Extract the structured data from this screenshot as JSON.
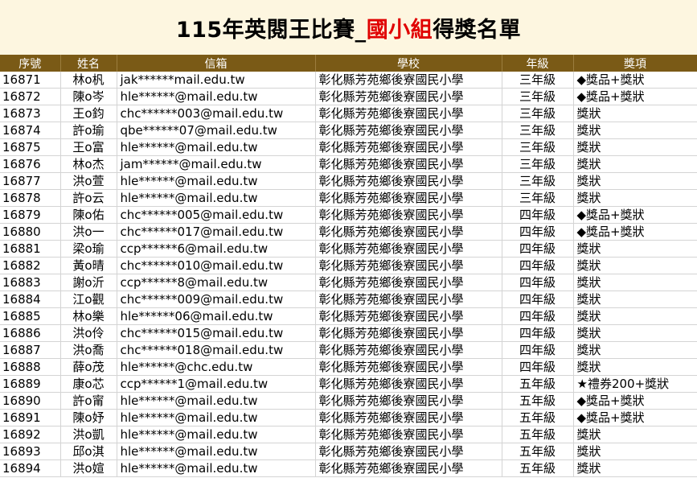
{
  "title": {
    "part1": "115年英閱王比賽_",
    "part2": "國小組",
    "part3": "得獎名單"
  },
  "headers": [
    "序號",
    "姓名",
    "信箱",
    "學校",
    "年級",
    "獎項"
  ],
  "rows": [
    [
      "16871",
      "林o杋",
      "jak******mail.edu.tw",
      "彰化縣芳苑鄉後寮國民小學",
      "三年級",
      "◆獎品+獎狀"
    ],
    [
      "16872",
      "陳o岑",
      "hle******@mail.edu.tw",
      "彰化縣芳苑鄉後寮國民小學",
      "三年級",
      "◆獎品+獎狀"
    ],
    [
      "16873",
      "王o鈞",
      "chc******003@mail.edu.tw",
      "彰化縣芳苑鄉後寮國民小學",
      "三年級",
      "獎狀"
    ],
    [
      "16874",
      "許o瑜",
      "qbe******07@mail.edu.tw",
      "彰化縣芳苑鄉後寮國民小學",
      "三年級",
      "獎狀"
    ],
    [
      "16875",
      "王o富",
      "hle******@mail.edu.tw",
      "彰化縣芳苑鄉後寮國民小學",
      "三年級",
      "獎狀"
    ],
    [
      "16876",
      "林o杰",
      "jam******@mail.edu.tw",
      "彰化縣芳苑鄉後寮國民小學",
      "三年級",
      "獎狀"
    ],
    [
      "16877",
      "洪o萱",
      "hle******@mail.edu.tw",
      "彰化縣芳苑鄉後寮國民小學",
      "三年級",
      "獎狀"
    ],
    [
      "16878",
      "許o云",
      "hle******@mail.edu.tw",
      "彰化縣芳苑鄉後寮國民小學",
      "三年級",
      "獎狀"
    ],
    [
      "16879",
      "陳o佑",
      "chc******005@mail.edu.tw",
      "彰化縣芳苑鄉後寮國民小學",
      "四年級",
      "◆獎品+獎狀"
    ],
    [
      "16880",
      "洪o一",
      "chc******017@mail.edu.tw",
      "彰化縣芳苑鄉後寮國民小學",
      "四年級",
      "◆獎品+獎狀"
    ],
    [
      "16881",
      "梁o瑜",
      "ccp******6@mail.edu.tw",
      "彰化縣芳苑鄉後寮國民小學",
      "四年級",
      "獎狀"
    ],
    [
      "16882",
      "黃o晴",
      "chc******010@mail.edu.tw",
      "彰化縣芳苑鄉後寮國民小學",
      "四年級",
      "獎狀"
    ],
    [
      "16883",
      "謝o沂",
      "ccp******8@mail.edu.tw",
      "彰化縣芳苑鄉後寮國民小學",
      "四年級",
      "獎狀"
    ],
    [
      "16884",
      "江o觀",
      "chc******009@mail.edu.tw",
      "彰化縣芳苑鄉後寮國民小學",
      "四年級",
      "獎狀"
    ],
    [
      "16885",
      "林o樂",
      "hle******06@mail.edu.tw",
      "彰化縣芳苑鄉後寮國民小學",
      "四年級",
      "獎狀"
    ],
    [
      "16886",
      "洪o伶",
      "chc******015@mail.edu.tw",
      "彰化縣芳苑鄉後寮國民小學",
      "四年級",
      "獎狀"
    ],
    [
      "16887",
      "洪o喬",
      "chc******018@mail.edu.tw",
      "彰化縣芳苑鄉後寮國民小學",
      "四年級",
      "獎狀"
    ],
    [
      "16888",
      "薛o茂",
      "hle******@chc.edu.tw",
      "彰化縣芳苑鄉後寮國民小學",
      "四年級",
      "獎狀"
    ],
    [
      "16889",
      "康o芯",
      "ccp******1@mail.edu.tw",
      "彰化縣芳苑鄉後寮國民小學",
      "五年級",
      "★禮券200+獎狀"
    ],
    [
      "16890",
      "許o甯",
      "hle******@mail.edu.tw",
      "彰化縣芳苑鄉後寮國民小學",
      "五年級",
      "◆獎品+獎狀"
    ],
    [
      "16891",
      "陳o妤",
      "hle******@mail.edu.tw",
      "彰化縣芳苑鄉後寮國民小學",
      "五年級",
      "◆獎品+獎狀"
    ],
    [
      "16892",
      "洪o凱",
      "hle******@mail.edu.tw",
      "彰化縣芳苑鄉後寮國民小學",
      "五年級",
      "獎狀"
    ],
    [
      "16893",
      "邱o淇",
      "hle******@mail.edu.tw",
      "彰化縣芳苑鄉後寮國民小學",
      "五年級",
      "獎狀"
    ],
    [
      "16894",
      "洪o媗",
      "hle******@mail.edu.tw",
      "彰化縣芳苑鄉後寮國民小學",
      "五年級",
      "獎狀"
    ]
  ],
  "colors": {
    "header_bg": "#7a5a16",
    "title_bg": "#fdf6e0",
    "accent": "#e00000"
  }
}
